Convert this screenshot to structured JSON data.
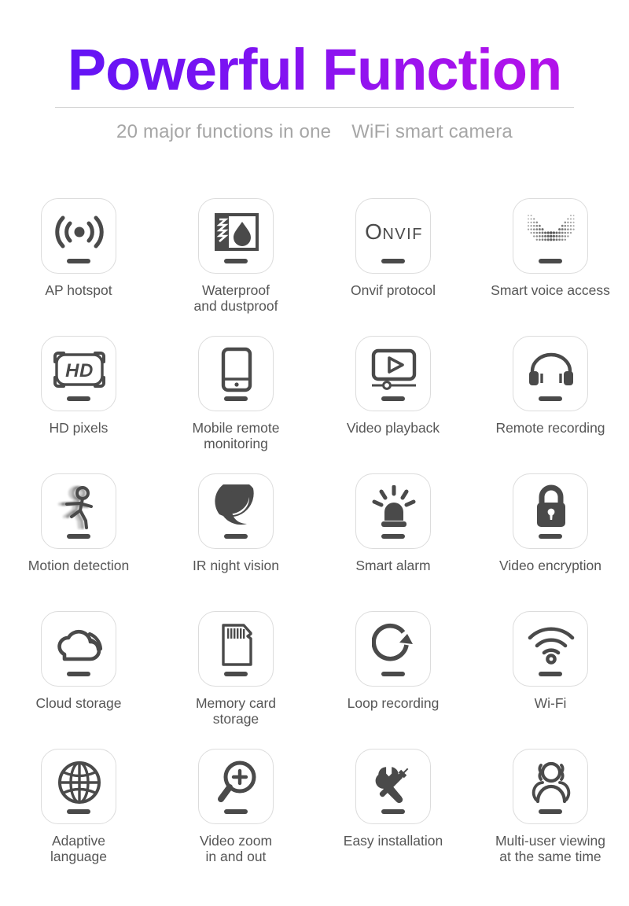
{
  "header": {
    "title_part1": "Powerful",
    "title_part2": "Function",
    "subtitle_left": "20 major functions in one",
    "subtitle_right": "WiFi smart camera",
    "gradient_start": "#6314f5",
    "gradient_end": "#b212ea",
    "subtitle_color": "#a6a6a6",
    "divider_color": "#d2d2d2"
  },
  "features": [
    {
      "icon": "ap-hotspot-icon",
      "label": "AP hotspot"
    },
    {
      "icon": "waterproof-dustproof-icon",
      "label": "Waterproof\nand dustproof"
    },
    {
      "icon": "onvif-logo-icon",
      "label": "Onvif protocol"
    },
    {
      "icon": "voice-waveform-icon",
      "label": "Smart voice access"
    },
    {
      "icon": "hd-badge-icon",
      "label": "HD pixels"
    },
    {
      "icon": "mobile-phone-icon",
      "label": "Mobile remote\nmonitoring"
    },
    {
      "icon": "video-playback-icon",
      "label": "Video playback"
    },
    {
      "icon": "headphones-icon",
      "label": "Remote recording"
    },
    {
      "icon": "running-person-icon",
      "label": "Motion detection"
    },
    {
      "icon": "crescent-moon-icon",
      "label": "IR night vision"
    },
    {
      "icon": "alarm-siren-icon",
      "label": "Smart alarm"
    },
    {
      "icon": "padlock-icon",
      "label": "Video encryption"
    },
    {
      "icon": "cloud-upload-icon",
      "label": "Cloud storage"
    },
    {
      "icon": "memory-card-icon",
      "label": "Memory card\nstorage"
    },
    {
      "icon": "loop-arrow-icon",
      "label": "Loop recording"
    },
    {
      "icon": "wifi-icon",
      "label": "Wi-Fi"
    },
    {
      "icon": "globe-icon",
      "label": "Adaptive\nlanguage"
    },
    {
      "icon": "magnifier-plus-icon",
      "label": "Video zoom\nin and out"
    },
    {
      "icon": "tools-icon",
      "label": "Easy installation"
    },
    {
      "icon": "multi-user-icon",
      "label": "Multi-user viewing\nat the same time"
    }
  ],
  "onvif_logo": {
    "big": "O",
    "small": "NVIF"
  },
  "hd_badge": {
    "text": "HD"
  },
  "icon_color": "#4a4a4a",
  "card_border_color": "#dcdcdc"
}
